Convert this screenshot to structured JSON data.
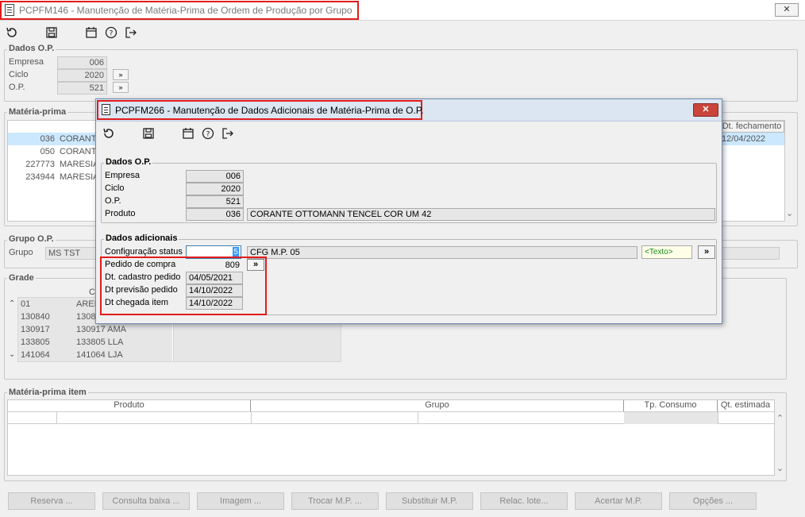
{
  "main_window": {
    "title": "PCPFM146 - Manutenção de Matéria-Prima de Ordem de Produção por Grupo",
    "close_label": "✕"
  },
  "dados_op": {
    "legend": "Dados O.P.",
    "empresa_label": "Empresa",
    "empresa_value": "006",
    "ciclo_label": "Ciclo",
    "ciclo_value": "2020",
    "op_label": "O.P.",
    "op_value": "521",
    "expand_label": "»"
  },
  "materia_prima": {
    "legend": "Matéria-prima",
    "column_dt_fechamento": "Dt. fechamento",
    "rows": [
      {
        "code": "036",
        "desc": "CORANTE",
        "dt": "12/04/2022"
      },
      {
        "code": "050",
        "desc": "CORANTE",
        "dt": ""
      },
      {
        "code": "227773",
        "desc": "MARESIA",
        "dt": ""
      },
      {
        "code": "234944",
        "desc": "MARESIA",
        "dt": ""
      }
    ]
  },
  "grupo_op": {
    "legend": "Grupo O.P.",
    "grupo_label": "Grupo",
    "grupo_value": "MS TST"
  },
  "grade": {
    "legend": "Grade",
    "header_fragment": "C",
    "rows": [
      {
        "a": "01",
        "b": "AREI"
      },
      {
        "a": "130840",
        "b": "1308"
      },
      {
        "a": "130917",
        "b": "130917 AMA"
      },
      {
        "a": "133805",
        "b": "133805 LLA"
      },
      {
        "a": "141064",
        "b": "141064 LJA"
      }
    ]
  },
  "mp_item": {
    "legend": "Matéria-prima item",
    "col_produto": "Produto",
    "col_grupo": "Grupo",
    "col_tp_consumo": "Tp. Consumo",
    "col_qt_estimada": "Qt. estimada"
  },
  "bottom_buttons": [
    "Reserva ...",
    "Consulta baixa ...",
    "Imagem ...",
    "Trocar M.P. ...",
    "Substituir M.P.",
    "Relac. lote...",
    "Acertar M.P.",
    "Opções ..."
  ],
  "modal": {
    "title": "PCPFM266 - Manutenção de Dados Adicionais de Matéria-Prima de O.P.",
    "close_label": "✕",
    "dados_op": {
      "legend": "Dados O.P.",
      "empresa_label": "Empresa",
      "empresa_value": "006",
      "ciclo_label": "Ciclo",
      "ciclo_value": "2020",
      "op_label": "O.P.",
      "op_value": "521",
      "produto_label": "Produto",
      "produto_code": "036",
      "produto_desc": "CORANTE OTTOMANN TENCEL COR UM 42"
    },
    "dados_adicionais": {
      "legend": "Dados adicionais",
      "config_status_label": "Configuração status",
      "config_status_value": "5",
      "config_status_desc": "CFG M.P. 05",
      "texto_label": "<Texto>",
      "expand_label": "»",
      "pedido_compra_label": "Pedido de compra",
      "pedido_compra_value": "809",
      "dt_cadastro_label": "Dt. cadastro pedido",
      "dt_cadastro_value": "04/05/2021",
      "dt_previsao_label": "Dt previsão pedido",
      "dt_previsao_value": "14/10/2022",
      "dt_chegada_label": "Dt chegada item",
      "dt_chegada_value": "14/10/2022"
    }
  },
  "icons": [
    "undo-icon",
    "save-icon",
    "calendar-icon",
    "help-icon",
    "exit-icon"
  ],
  "colors": {
    "highlight": "#e21b1b",
    "selected_row": "#cce8ff",
    "texto_green": "#1a8a1a"
  }
}
